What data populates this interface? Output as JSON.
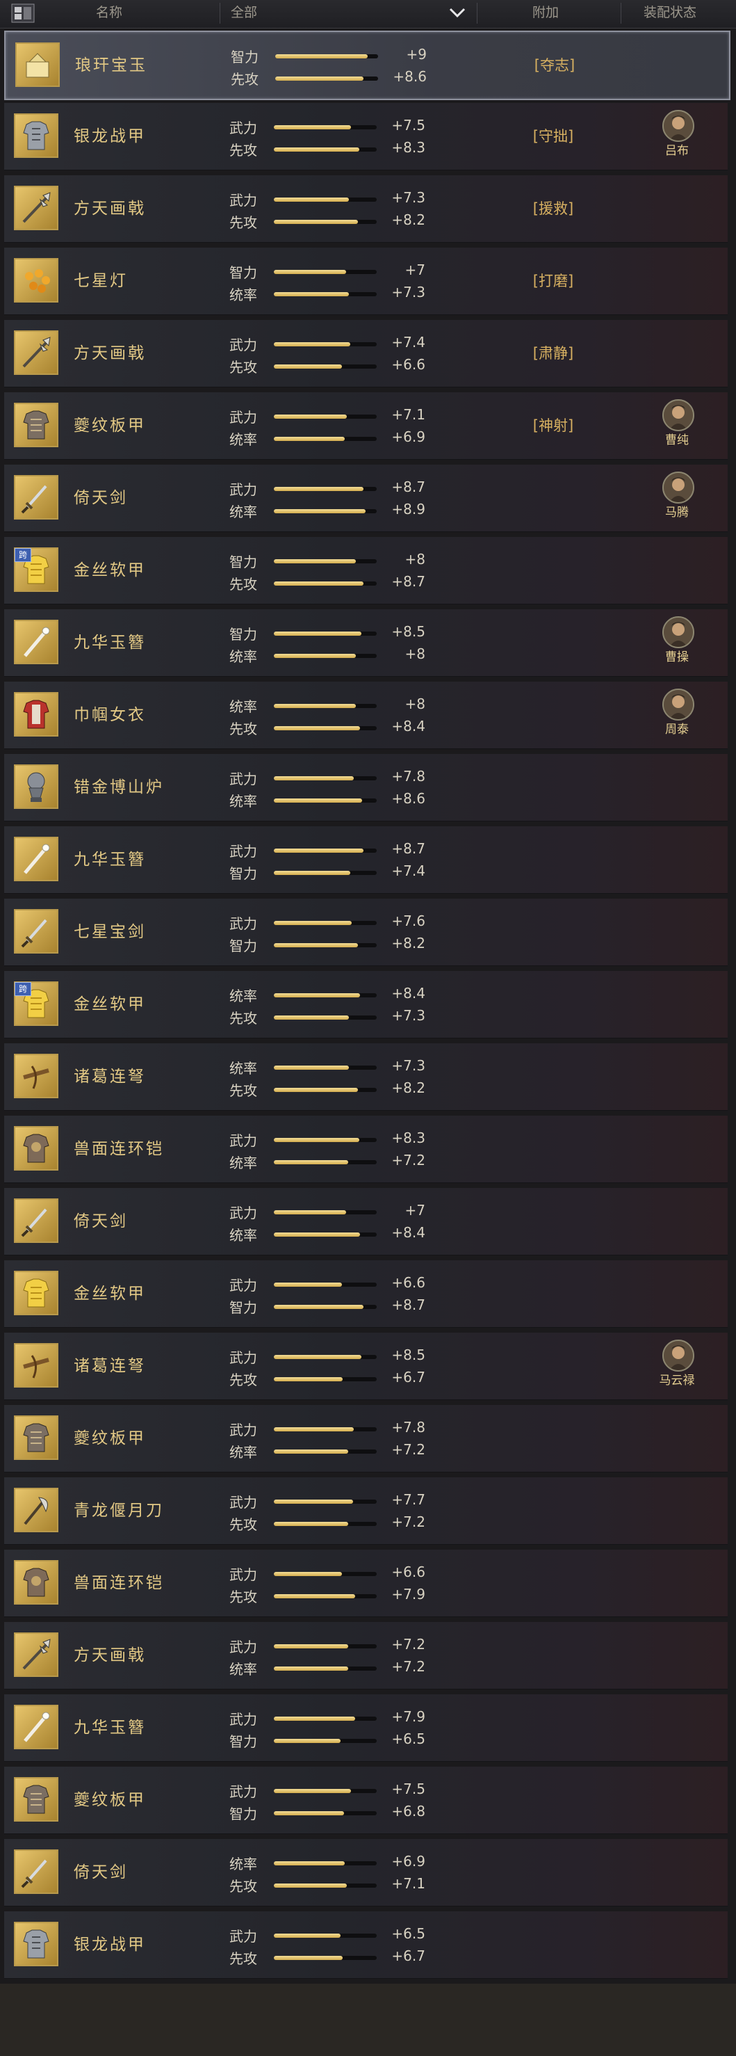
{
  "header": {
    "col_name": "名称",
    "col_filter": "全部",
    "col_bonus": "附加",
    "col_status": "装配状态"
  },
  "colors": {
    "accent_gold": "#e3c985",
    "bar_fill": "#e8c36c",
    "tag_color": "#d7b061"
  },
  "items": [
    {
      "name": "琅玕宝玉",
      "icon": "jade-treasure-icon",
      "stats": [
        {
          "label": "智力",
          "value": "+9",
          "level": 0.9
        },
        {
          "label": "先攻",
          "value": "+8.6",
          "level": 0.86
        }
      ],
      "tag": "[夺志]",
      "hero": null,
      "selected": true
    },
    {
      "name": "银龙战甲",
      "icon": "silver-armor-icon",
      "stats": [
        {
          "label": "武力",
          "value": "+7.5",
          "level": 0.75
        },
        {
          "label": "先攻",
          "value": "+8.3",
          "level": 0.83
        }
      ],
      "tag": "[守拙]",
      "hero": "吕布"
    },
    {
      "name": "方天画戟",
      "icon": "halberd-icon",
      "stats": [
        {
          "label": "武力",
          "value": "+7.3",
          "level": 0.73
        },
        {
          "label": "先攻",
          "value": "+8.2",
          "level": 0.82
        }
      ],
      "tag": "[援救]",
      "hero": null
    },
    {
      "name": "七星灯",
      "icon": "seven-star-lamp-icon",
      "stats": [
        {
          "label": "智力",
          "value": "+7",
          "level": 0.7
        },
        {
          "label": "统率",
          "value": "+7.3",
          "level": 0.73
        }
      ],
      "tag": "[打磨]",
      "hero": null
    },
    {
      "name": "方天画戟",
      "icon": "halberd-icon",
      "stats": [
        {
          "label": "武力",
          "value": "+7.4",
          "level": 0.74
        },
        {
          "label": "先攻",
          "value": "+6.6",
          "level": 0.66
        }
      ],
      "tag": "[肃静]",
      "hero": null
    },
    {
      "name": "夔纹板甲",
      "icon": "plate-armor-icon",
      "stats": [
        {
          "label": "武力",
          "value": "+7.1",
          "level": 0.71
        },
        {
          "label": "统率",
          "value": "+6.9",
          "level": 0.69
        }
      ],
      "tag": "[神射]",
      "hero": "曹纯"
    },
    {
      "name": "倚天剑",
      "icon": "sword-icon",
      "stats": [
        {
          "label": "武力",
          "value": "+8.7",
          "level": 0.87
        },
        {
          "label": "统率",
          "value": "+8.9",
          "level": 0.89
        }
      ],
      "tag": null,
      "hero": "马腾"
    },
    {
      "name": "金丝软甲",
      "icon": "gold-silk-armor-icon",
      "stats": [
        {
          "label": "智力",
          "value": "+8",
          "level": 0.8
        },
        {
          "label": "先攻",
          "value": "+8.7",
          "level": 0.87
        }
      ],
      "tag": null,
      "hero": null,
      "badge": "跨"
    },
    {
      "name": "九华玉簪",
      "icon": "jade-hairpin-icon",
      "stats": [
        {
          "label": "智力",
          "value": "+8.5",
          "level": 0.85
        },
        {
          "label": "统率",
          "value": "+8",
          "level": 0.8
        }
      ],
      "tag": null,
      "hero": "曹操"
    },
    {
      "name": "巾帼女衣",
      "icon": "female-robe-icon",
      "stats": [
        {
          "label": "统率",
          "value": "+8",
          "level": 0.8
        },
        {
          "label": "先攻",
          "value": "+8.4",
          "level": 0.84
        }
      ],
      "tag": null,
      "hero": "周泰"
    },
    {
      "name": "错金博山炉",
      "icon": "incense-burner-icon",
      "stats": [
        {
          "label": "武力",
          "value": "+7.8",
          "level": 0.78
        },
        {
          "label": "统率",
          "value": "+8.6",
          "level": 0.86
        }
      ],
      "tag": null,
      "hero": null
    },
    {
      "name": "九华玉簪",
      "icon": "jade-hairpin-icon",
      "stats": [
        {
          "label": "武力",
          "value": "+8.7",
          "level": 0.87
        },
        {
          "label": "智力",
          "value": "+7.4",
          "level": 0.74
        }
      ],
      "tag": null,
      "hero": null
    },
    {
      "name": "七星宝剑",
      "icon": "sword-icon",
      "stats": [
        {
          "label": "武力",
          "value": "+7.6",
          "level": 0.76
        },
        {
          "label": "智力",
          "value": "+8.2",
          "level": 0.82
        }
      ],
      "tag": null,
      "hero": null
    },
    {
      "name": "金丝软甲",
      "icon": "gold-silk-armor-icon",
      "stats": [
        {
          "label": "统率",
          "value": "+8.4",
          "level": 0.84
        },
        {
          "label": "先攻",
          "value": "+7.3",
          "level": 0.73
        }
      ],
      "tag": null,
      "hero": null,
      "badge": "跨"
    },
    {
      "name": "诸葛连弩",
      "icon": "crossbow-icon",
      "stats": [
        {
          "label": "统率",
          "value": "+7.3",
          "level": 0.73
        },
        {
          "label": "先攻",
          "value": "+8.2",
          "level": 0.82
        }
      ],
      "tag": null,
      "hero": null
    },
    {
      "name": "兽面连环铠",
      "icon": "beast-armor-icon",
      "stats": [
        {
          "label": "武力",
          "value": "+8.3",
          "level": 0.83
        },
        {
          "label": "统率",
          "value": "+7.2",
          "level": 0.72
        }
      ],
      "tag": null,
      "hero": null
    },
    {
      "name": "倚天剑",
      "icon": "sword-icon",
      "stats": [
        {
          "label": "武力",
          "value": "+7",
          "level": 0.7
        },
        {
          "label": "统率",
          "value": "+8.4",
          "level": 0.84
        }
      ],
      "tag": null,
      "hero": null
    },
    {
      "name": "金丝软甲",
      "icon": "gold-silk-armor-icon",
      "stats": [
        {
          "label": "武力",
          "value": "+6.6",
          "level": 0.66
        },
        {
          "label": "智力",
          "value": "+8.7",
          "level": 0.87
        }
      ],
      "tag": null,
      "hero": null
    },
    {
      "name": "诸葛连弩",
      "icon": "crossbow-icon",
      "stats": [
        {
          "label": "武力",
          "value": "+8.5",
          "level": 0.85
        },
        {
          "label": "先攻",
          "value": "+6.7",
          "level": 0.67
        }
      ],
      "tag": null,
      "hero": "马云禄"
    },
    {
      "name": "夔纹板甲",
      "icon": "plate-armor-icon",
      "stats": [
        {
          "label": "武力",
          "value": "+7.8",
          "level": 0.78
        },
        {
          "label": "统率",
          "value": "+7.2",
          "level": 0.72
        }
      ],
      "tag": null,
      "hero": null
    },
    {
      "name": "青龙偃月刀",
      "icon": "crescent-blade-icon",
      "stats": [
        {
          "label": "武力",
          "value": "+7.7",
          "level": 0.77
        },
        {
          "label": "先攻",
          "value": "+7.2",
          "level": 0.72
        }
      ],
      "tag": null,
      "hero": null
    },
    {
      "name": "兽面连环铠",
      "icon": "beast-armor-icon",
      "stats": [
        {
          "label": "武力",
          "value": "+6.6",
          "level": 0.66
        },
        {
          "label": "先攻",
          "value": "+7.9",
          "level": 0.79
        }
      ],
      "tag": null,
      "hero": null
    },
    {
      "name": "方天画戟",
      "icon": "halberd-icon",
      "stats": [
        {
          "label": "武力",
          "value": "+7.2",
          "level": 0.72
        },
        {
          "label": "统率",
          "value": "+7.2",
          "level": 0.72
        }
      ],
      "tag": null,
      "hero": null
    },
    {
      "name": "九华玉簪",
      "icon": "jade-hairpin-icon",
      "stats": [
        {
          "label": "武力",
          "value": "+7.9",
          "level": 0.79
        },
        {
          "label": "智力",
          "value": "+6.5",
          "level": 0.65
        }
      ],
      "tag": null,
      "hero": null
    },
    {
      "name": "夔纹板甲",
      "icon": "plate-armor-icon",
      "stats": [
        {
          "label": "武力",
          "value": "+7.5",
          "level": 0.75
        },
        {
          "label": "智力",
          "value": "+6.8",
          "level": 0.68
        }
      ],
      "tag": null,
      "hero": null
    },
    {
      "name": "倚天剑",
      "icon": "sword-icon",
      "stats": [
        {
          "label": "统率",
          "value": "+6.9",
          "level": 0.69
        },
        {
          "label": "先攻",
          "value": "+7.1",
          "level": 0.71
        }
      ],
      "tag": null,
      "hero": null
    },
    {
      "name": "银龙战甲",
      "icon": "silver-armor-icon",
      "stats": [
        {
          "label": "武力",
          "value": "+6.5",
          "level": 0.65
        },
        {
          "label": "先攻",
          "value": "+6.7",
          "level": 0.67
        }
      ],
      "tag": null,
      "hero": null
    }
  ]
}
